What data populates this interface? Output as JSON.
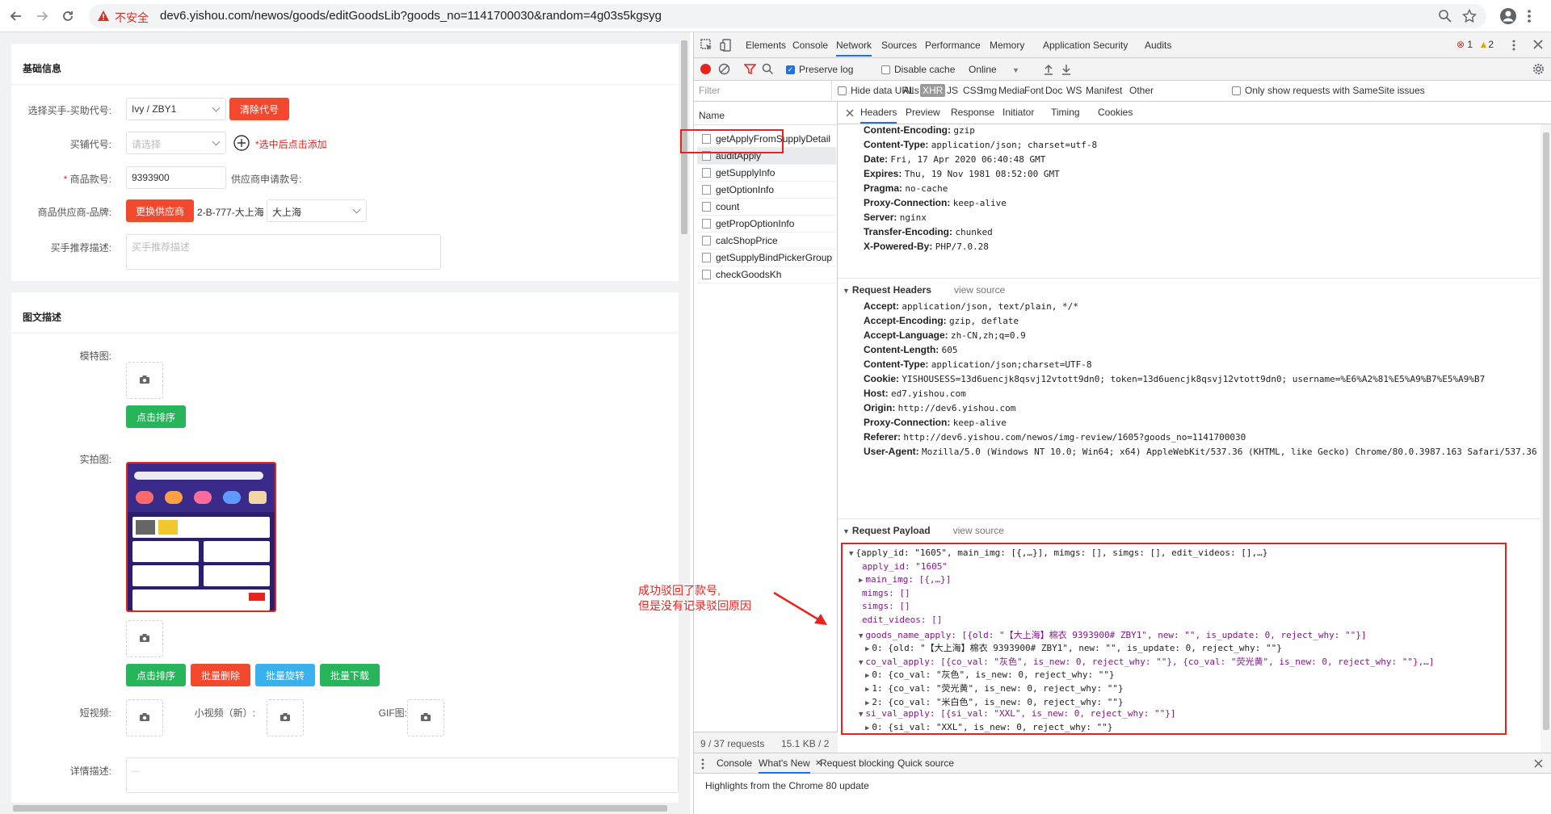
{
  "browser": {
    "insecure_label": "不安全",
    "url": "dev6.yishou.com/newos/goods/editGoodsLib?goods_no=1141700030&random=4g03s5kgsyg"
  },
  "left": {
    "basic": {
      "title": "基础信息",
      "buyer_label": "选择买手-买助代号:",
      "buyer_value": "Ivy / ZBY1",
      "clear_btn": "清除代号",
      "shop_label": "买铺代号:",
      "shop_placeholder": "请选择",
      "shop_hint": "*选中后点击添加",
      "goods_no_label": "商品款号:",
      "goods_no_value": "9393900",
      "supplier_no_label": "供应商申请款号:",
      "supplier_label": "商品供应商-品牌:",
      "change_supplier_btn": "更换供应商",
      "supplier_code": "2-B-777-大上海",
      "brand_value": "大上海",
      "desc_label": "买手推荐描述:",
      "desc_placeholder": "买手推荐描述"
    },
    "media": {
      "title": "图文描述",
      "model_label": "模特图:",
      "sort_btn_1": "点击排序",
      "real_label": "实拍图:",
      "sort_btn_2": "点击排序",
      "batch_delete": "批量删除",
      "batch_rotate": "批量旋转",
      "batch_download": "批量下载",
      "video_label": "短视频:",
      "mini_video_label": "小视频（新）:",
      "gif_label": "GIF图:",
      "detail_label": "详情描述:",
      "detail_placeholder": "..."
    }
  },
  "devtools": {
    "tabs": [
      "Elements",
      "Console",
      "Network",
      "Sources",
      "Performance",
      "Memory",
      "Application",
      "Security",
      "Audits"
    ],
    "active_tab": "Network",
    "errors": "1",
    "warnings": "2",
    "toolbar": {
      "preserve_log": "Preserve log",
      "disable_cache": "Disable cache",
      "online": "Online"
    },
    "filter": {
      "placeholder": "Filter",
      "hide_data_urls": "Hide data URLs",
      "types": [
        "All",
        "XHR",
        "JS",
        "CSS",
        "Img",
        "Media",
        "Font",
        "Doc",
        "WS",
        "Manifest",
        "Other"
      ],
      "active_type": "XHR",
      "samesite": "Only show requests with SameSite issues"
    },
    "name_header": "Name",
    "requests": [
      "getApplyFromSupplyDetail",
      "auditApply",
      "getSupplyInfo",
      "getOptionInfo",
      "count",
      "getPropOptionInfo",
      "calcShopPrice",
      "getSupplyBindPickerGroup",
      "checkGoodsKh"
    ],
    "selected_request": "auditApply",
    "status": {
      "requests": "9 / 37 requests",
      "size": "15.1 KB / 2"
    },
    "detail_tabs": [
      "Headers",
      "Preview",
      "Response",
      "Initiator",
      "Timing",
      "Cookies"
    ],
    "response_headers": [
      {
        "k": "Content-Encoding:",
        "v": "gzip"
      },
      {
        "k": "Content-Type:",
        "v": "application/json; charset=utf-8"
      },
      {
        "k": "Date:",
        "v": "Fri, 17 Apr 2020 06:40:48 GMT"
      },
      {
        "k": "Expires:",
        "v": "Thu, 19 Nov 1981 08:52:00 GMT"
      },
      {
        "k": "Pragma:",
        "v": "no-cache"
      },
      {
        "k": "Proxy-Connection:",
        "v": "keep-alive"
      },
      {
        "k": "Server:",
        "v": "nginx"
      },
      {
        "k": "Transfer-Encoding:",
        "v": "chunked"
      },
      {
        "k": "X-Powered-By:",
        "v": "PHP/7.0.28"
      }
    ],
    "request_headers_title": "Request Headers",
    "view_source": "view source",
    "request_headers": [
      {
        "k": "Accept:",
        "v": "application/json, text/plain, */*"
      },
      {
        "k": "Accept-Encoding:",
        "v": "gzip, deflate"
      },
      {
        "k": "Accept-Language:",
        "v": "zh-CN,zh;q=0.9"
      },
      {
        "k": "Content-Length:",
        "v": "605"
      },
      {
        "k": "Content-Type:",
        "v": "application/json;charset=UTF-8"
      },
      {
        "k": "Cookie:",
        "v": "YISHOUSESS=13d6uencjk8qsvj12vtott9dn0; token=13d6uencjk8qsvj12vtott9dn0; username=%E6%A2%81%E5%A9%B7%E5%A9%B7"
      },
      {
        "k": "Host:",
        "v": "ed7.yishou.com"
      },
      {
        "k": "Origin:",
        "v": "http://dev6.yishou.com"
      },
      {
        "k": "Proxy-Connection:",
        "v": "keep-alive"
      },
      {
        "k": "Referer:",
        "v": "http://dev6.yishou.com/newos/img-review/1605?goods_no=1141700030"
      },
      {
        "k": "User-Agent:",
        "v": "Mozilla/5.0 (Windows NT 10.0; Win64; x64) AppleWebKit/537.36 (KHTML, like Gecko) Chrome/80.0.3987.163 Safari/537.36"
      }
    ],
    "payload_title": "Request Payload",
    "payload_lines": [
      "{apply_id: \"1605\", main_img: [{,…}], mimgs: [], simgs: [], edit_videos: [],…}",
      "apply_id: \"1605\"",
      "main_img: [{,…}]",
      "mimgs: []",
      "simgs: []",
      "edit_videos: []",
      "goods_name_apply: [{old: \"【大上海】棉衣 9393900# ZBY1\", new: \"\", is_update: 0, reject_why: \"\"}]",
      "0: {old: \"【大上海】棉衣 9393900# ZBY1\", new: \"\", is_update: 0, reject_why: \"\"}",
      "co_val_apply: [{co_val: \"灰色\", is_new: 0, reject_why: \"\"}, {co_val: \"荧光黄\", is_new: 0, reject_why: \"\"},…]",
      "0: {co_val: \"灰色\", is_new: 0, reject_why: \"\"}",
      "1: {co_val: \"荧光黄\", is_new: 0, reject_why: \"\"}",
      "2: {co_val: \"米白色\", is_new: 0, reject_why: \"\"}",
      "si_val_apply: [{si_val: \"XXL\", is_new: 0, reject_why: \"\"}]",
      "0: {si_val: \"XXL\", is_new: 0, reject_why: \"\"}"
    ],
    "drawer_tabs": [
      "Console",
      "What's New",
      "Request blocking",
      "Quick source"
    ],
    "drawer_active": "What's New",
    "drawer_text": "Highlights from the Chrome 80 update"
  },
  "annotation": {
    "line1": "成功驳回了款号,",
    "line2": "但是没有记录驳回原因"
  },
  "colors": {
    "accent_red": "#e8231e",
    "devtools_blue": "#1a73e8",
    "green_btn": "#27b45a"
  }
}
